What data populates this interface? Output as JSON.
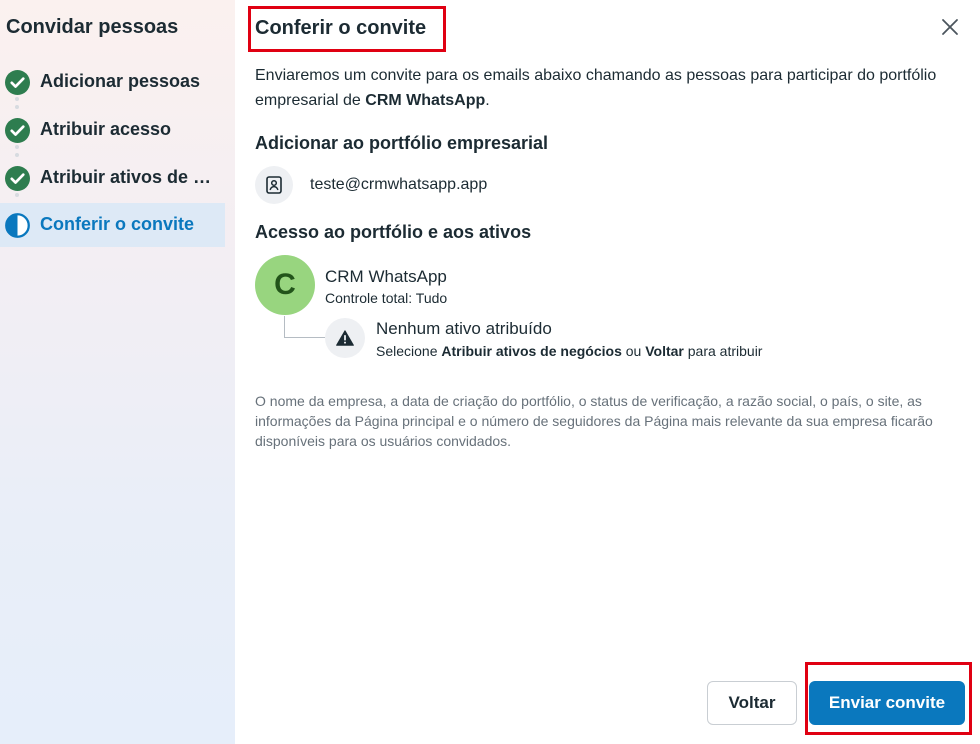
{
  "sidebar": {
    "title": "Convidar pessoas",
    "steps": [
      {
        "label": "Adicionar pessoas",
        "state": "done",
        "icon": "check-circle-icon"
      },
      {
        "label": "Atribuir acesso",
        "state": "done",
        "icon": "check-circle-icon"
      },
      {
        "label": "Atribuir ativos de negócios",
        "state": "done",
        "icon": "check-circle-icon"
      },
      {
        "label": "Conferir o convite",
        "state": "active",
        "icon": "half-circle-icon"
      }
    ]
  },
  "main": {
    "title": "Conferir o convite",
    "intro_prefix": "Enviaremos um convite para os emails abaixo chamando as pessoas para participar do portfólio empresarial de ",
    "intro_business": "CRM WhatsApp",
    "intro_suffix": ".",
    "add_section_title": "Adicionar ao portfólio empresarial",
    "email": "teste@crmwhatsapp.app",
    "access_section_title": "Acesso ao portfólio e aos ativos",
    "business": {
      "avatar_letter": "C",
      "name": "CRM WhatsApp",
      "access": "Controle total: Tudo"
    },
    "no_assets": {
      "title": "Nenhum ativo atribuído",
      "sub_1": "Selecione ",
      "sub_link_1": "Atribuir ativos de negócios",
      "sub_2": " ou ",
      "sub_link_2": "Voltar",
      "sub_3": " para atribuir"
    },
    "disclaimer": "O nome da empresa, a data de criação do portfólio, o status de verificação, a razão social, o país, o site, as informações da Página principal e o número de seguidores da Página mais relevante da sua empresa ficarão disponíveis para os usuários convidados."
  },
  "footer": {
    "back_label": "Voltar",
    "send_label": "Enviar convite"
  },
  "colors": {
    "accent": "#0a78be",
    "check": "#2e8b57",
    "highlight": "#e00012",
    "avatar": "#98d57f"
  }
}
